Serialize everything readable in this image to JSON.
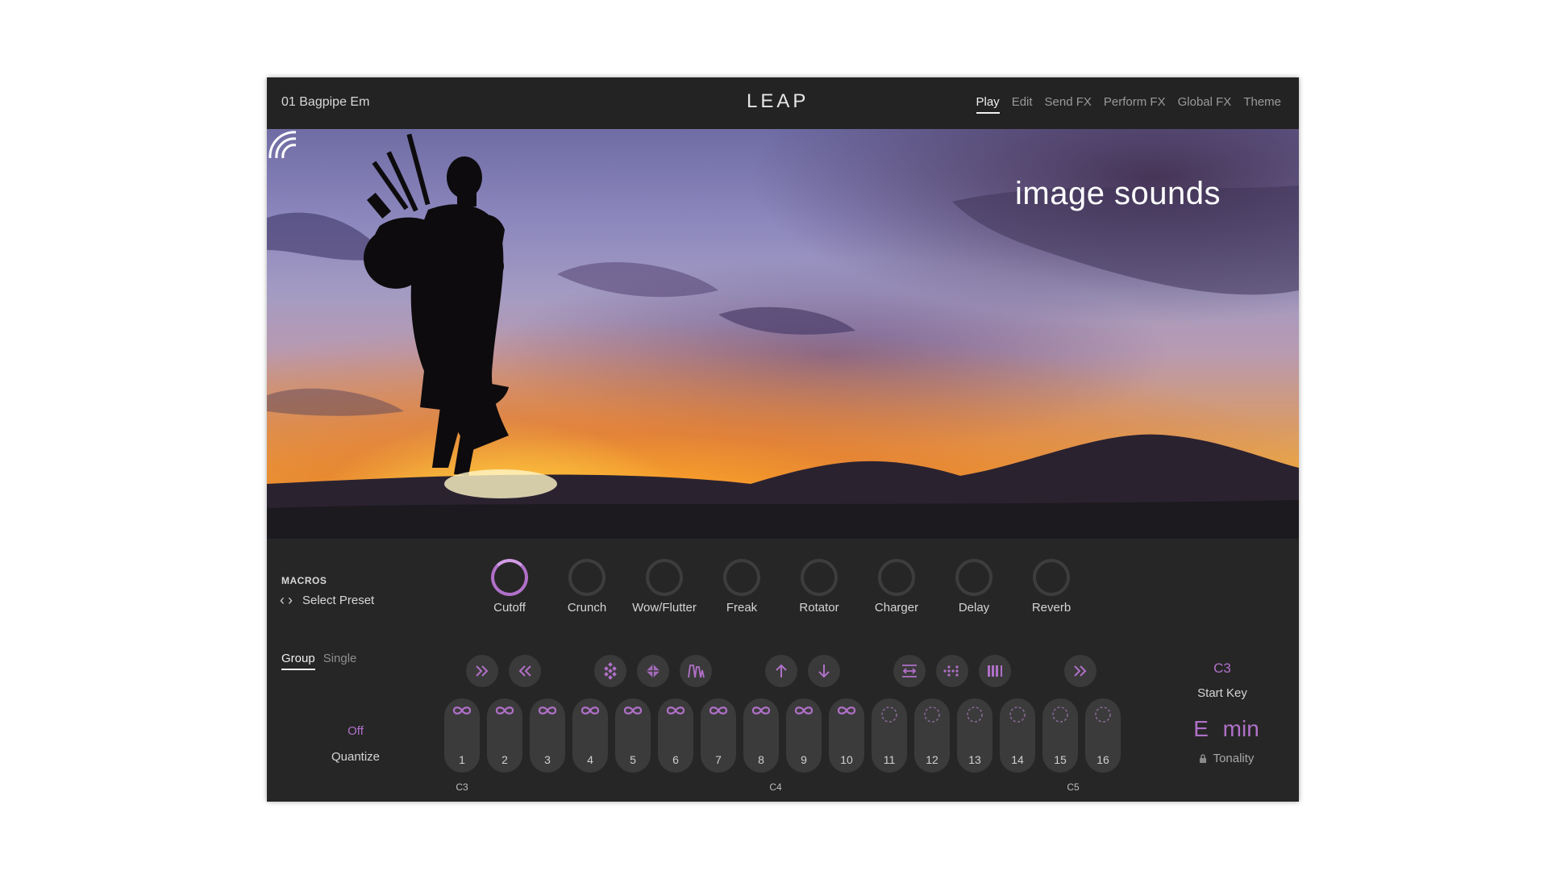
{
  "header": {
    "preset_name": "01 Bagpipe Em",
    "logo": "LEAP",
    "tabs": [
      {
        "label": "Play",
        "active": true
      },
      {
        "label": "Edit",
        "active": false
      },
      {
        "label": "Send FX",
        "active": false
      },
      {
        "label": "Perform FX",
        "active": false
      },
      {
        "label": "Global FX",
        "active": false
      },
      {
        "label": "Theme",
        "active": false
      }
    ]
  },
  "hero": {
    "brand": "image sounds"
  },
  "macros": {
    "title": "MACROS",
    "select_preset": "Select Preset",
    "knobs": [
      {
        "label": "Cutoff",
        "active": true
      },
      {
        "label": "Crunch",
        "active": false
      },
      {
        "label": "Wow/Flutter",
        "active": false
      },
      {
        "label": "Freak",
        "active": false
      },
      {
        "label": "Rotator",
        "active": false
      },
      {
        "label": "Charger",
        "active": false
      },
      {
        "label": "Delay",
        "active": false
      },
      {
        "label": "Reverb",
        "active": false
      }
    ]
  },
  "mode": {
    "group": "Group",
    "single": "Single",
    "active": "Group"
  },
  "quantize": {
    "value": "Off",
    "label": "Quantize"
  },
  "actions": [
    {
      "icon": "fast-forward-icon"
    },
    {
      "icon": "rewind-icon"
    },
    {
      "icon": "scatter-icon"
    },
    {
      "icon": "grid-scatter-icon"
    },
    {
      "icon": "waveform-icon"
    },
    {
      "icon": "arrow-up-icon"
    },
    {
      "icon": "arrow-down-icon"
    },
    {
      "icon": "swap-icon"
    },
    {
      "icon": "reverse-dots-icon"
    },
    {
      "icon": "bars-icon"
    },
    {
      "icon": "skip-forward-icon"
    }
  ],
  "pads": [
    {
      "number": "1",
      "state": "loop"
    },
    {
      "number": "2",
      "state": "loop"
    },
    {
      "number": "3",
      "state": "loop"
    },
    {
      "number": "4",
      "state": "loop"
    },
    {
      "number": "5",
      "state": "loop"
    },
    {
      "number": "6",
      "state": "loop"
    },
    {
      "number": "7",
      "state": "loop"
    },
    {
      "number": "8",
      "state": "loop"
    },
    {
      "number": "9",
      "state": "loop"
    },
    {
      "number": "10",
      "state": "loop"
    },
    {
      "number": "11",
      "state": "oneshot"
    },
    {
      "number": "12",
      "state": "oneshot"
    },
    {
      "number": "13",
      "state": "oneshot"
    },
    {
      "number": "14",
      "state": "oneshot"
    },
    {
      "number": "15",
      "state": "oneshot"
    },
    {
      "number": "16",
      "state": "oneshot"
    }
  ],
  "key_labels": [
    "C3",
    "C4",
    "C5"
  ],
  "start_key": {
    "value": "C3",
    "label": "Start Key"
  },
  "tonality": {
    "value": "E  min",
    "label": "Tonality"
  },
  "colors": {
    "accent": "#b070c8",
    "panel": "#262626",
    "pad": "#3b3b3b"
  }
}
